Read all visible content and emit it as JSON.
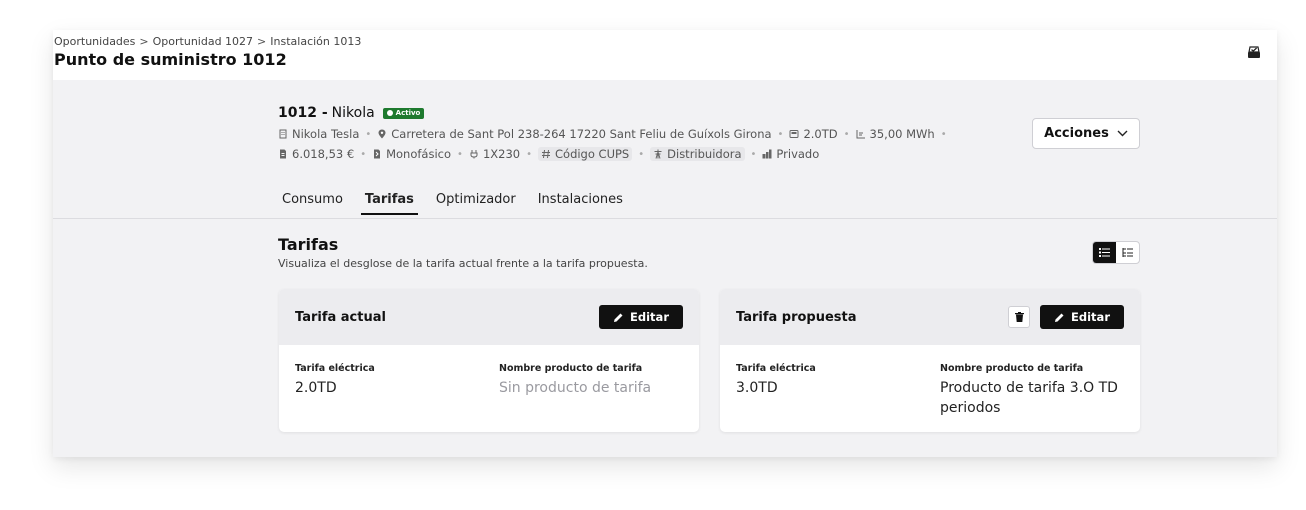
{
  "breadcrumb": [
    "Oportunidades",
    "Oportunidad 1027",
    "Instalación 1013"
  ],
  "page_title": "Punto de suministro 1012",
  "summary": {
    "id": "1012 -",
    "name": "Nikola",
    "status_badge": "Activo",
    "meta": [
      {
        "icon": "building-icon",
        "text": "Nikola Tesla"
      },
      {
        "icon": "location-pin-icon",
        "text": "Carretera de Sant Pol 238-264 17220 Sant Feliu de Guíxols Girona"
      },
      {
        "icon": "meter-icon",
        "text": "2.0TD"
      },
      {
        "icon": "chart-icon",
        "text": "35,00 MWh"
      }
    ],
    "meta2": [
      {
        "icon": "invoice-icon",
        "text": "6.018,53 €"
      },
      {
        "icon": "phase-icon",
        "text": "Monofásico"
      },
      {
        "icon": "plug-icon",
        "text": "1X230"
      },
      {
        "icon": "hash-icon",
        "text": "Código CUPS",
        "chip": true
      },
      {
        "icon": "tower-icon",
        "text": "Distribuidora",
        "chip": true
      },
      {
        "icon": "signal-icon",
        "text": "Privado"
      }
    ]
  },
  "actions_label": "Acciones",
  "tabs": [
    {
      "label": "Consumo",
      "active": false
    },
    {
      "label": "Tarifas",
      "active": true
    },
    {
      "label": "Optimizador",
      "active": false
    },
    {
      "label": "Instalaciones",
      "active": false
    }
  ],
  "section": {
    "title": "Tarifas",
    "description": "Visualiza el desglose de la tarifa actual frente a la tarifa propuesta."
  },
  "cards": {
    "actual": {
      "title": "Tarifa actual",
      "edit_label": "Editar",
      "tarifa_label": "Tarifa eléctrica",
      "tarifa_value": "2.0TD",
      "producto_label": "Nombre producto de tarifa",
      "producto_value": "Sin producto de tarifa"
    },
    "propuesta": {
      "title": "Tarifa propuesta",
      "edit_label": "Editar",
      "tarifa_label": "Tarifa eléctrica",
      "tarifa_value": "3.0TD",
      "producto_label": "Nombre producto de tarifa",
      "producto_value": "Producto de tarifa 3.O TD periodos"
    }
  },
  "colors": {
    "accent": "#111111",
    "badge": "#1e7a2e",
    "background": "#f2f2f4"
  }
}
